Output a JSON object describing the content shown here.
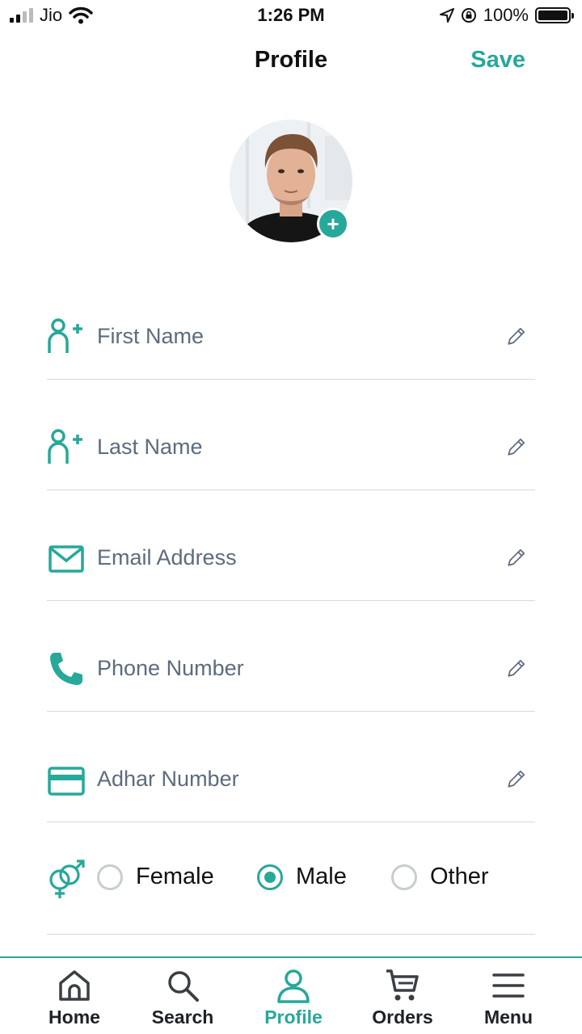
{
  "status_bar": {
    "carrier": "Jio",
    "time": "1:26 PM",
    "battery": "100%"
  },
  "header": {
    "title": "Profile",
    "save_label": "Save"
  },
  "avatar": {
    "add_symbol": "+"
  },
  "fields": [
    {
      "label": "First Name",
      "icon": "add-user-icon"
    },
    {
      "label": "Last Name",
      "icon": "add-user-icon"
    },
    {
      "label": "Email Address",
      "icon": "mail-icon"
    },
    {
      "label": "Phone Number",
      "icon": "phone-icon"
    },
    {
      "label": "Adhar Number",
      "icon": "card-icon"
    }
  ],
  "gender": {
    "icon": "gender-icon",
    "options": [
      "Female",
      "Male",
      "Other"
    ],
    "selected": "Male"
  },
  "bottom_nav": {
    "items": [
      {
        "label": "Home",
        "icon": "home-icon"
      },
      {
        "label": "Search",
        "icon": "search-icon"
      },
      {
        "label": "Profile",
        "icon": "user-icon"
      },
      {
        "label": "Orders",
        "icon": "cart-icon"
      },
      {
        "label": "Menu",
        "icon": "menu-icon"
      }
    ],
    "active": "Profile"
  },
  "colors": {
    "accent": "#26a89a",
    "field_text": "#5d6b7e",
    "divider": "#d6d9dc"
  }
}
